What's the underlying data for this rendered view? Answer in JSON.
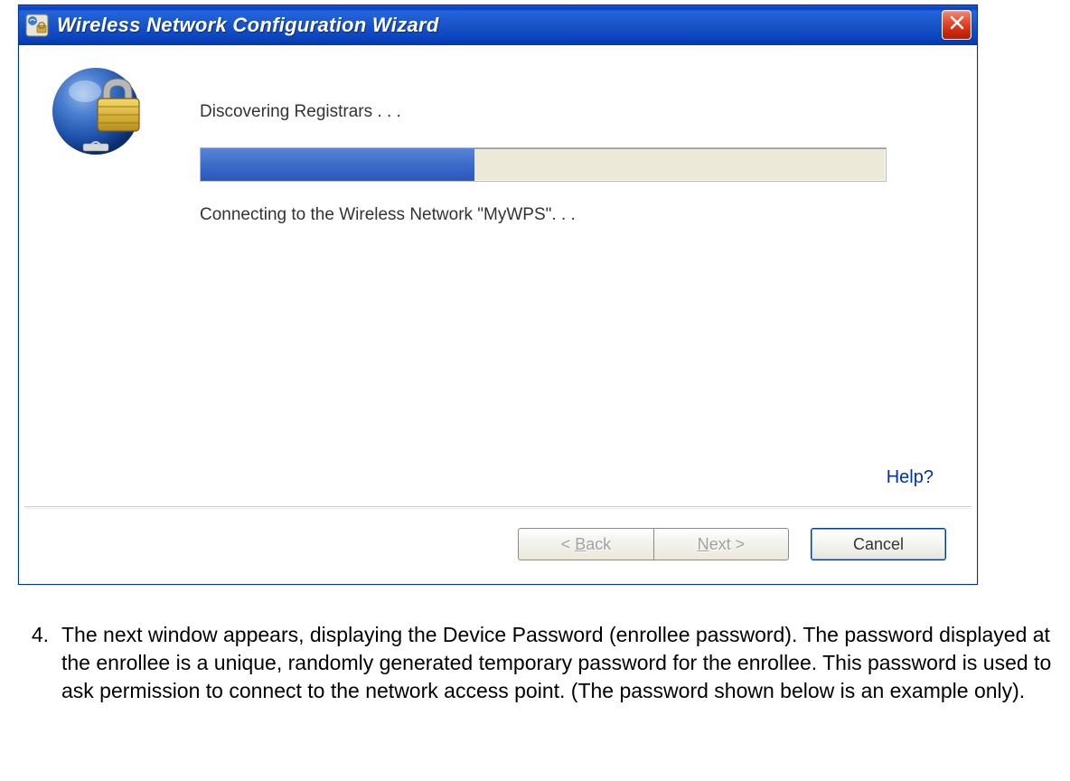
{
  "window": {
    "title": "Wireless Network Configuration Wizard"
  },
  "content": {
    "discovering_label": "Discovering Registrars . . .",
    "connecting_label": "Connecting to the Wireless Network \"MyWPS\". . .",
    "progress_percent": 40,
    "help_label": "Help?"
  },
  "buttons": {
    "back_prefix": "< ",
    "back_key": "B",
    "back_rest": "ack",
    "next_key": "N",
    "next_rest": "ext >",
    "cancel": "Cancel"
  },
  "doc": {
    "num": "4.",
    "text": "The next window appears, displaying the Device Password (enrollee password). The password displayed at the enrollee is a unique, randomly generated temporary password for the enrollee. This password is used to ask permission to connect to the network access point. (The password shown below is an example only)."
  }
}
